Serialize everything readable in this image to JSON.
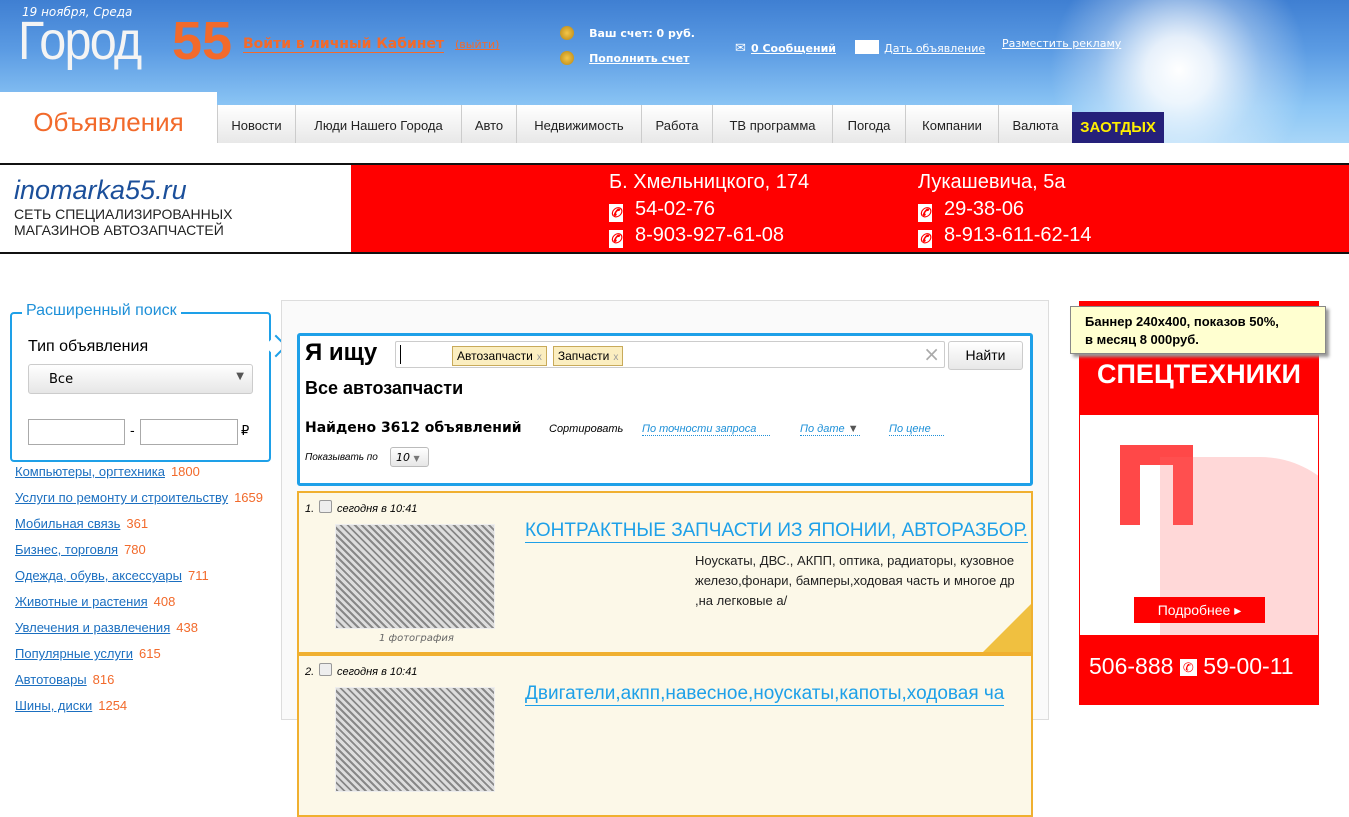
{
  "header": {
    "date": "19 ноября, Среда",
    "logo_text": "Город",
    "logo_number": "55",
    "login": "Войти в личный Кабинет",
    "logout": "(выйти)",
    "account": "Ваш счет: 0 руб.",
    "topup": "Пополнить счет",
    "messages": "0 Сообщений",
    "post_ad": "Дать объявление",
    "advertise": "Разместить рекламу"
  },
  "nav": {
    "active": "Объявления",
    "tabs": [
      "Новости",
      "Люди Нашего Города",
      "Авто",
      "Недвижимость",
      "Работа",
      "ТВ программа",
      "Погода",
      "Компании",
      "Валюта"
    ],
    "special": "ЗАОТДЫХ"
  },
  "ad_banner": {
    "site": "inomarka55.ru",
    "sub1": "СЕТЬ СПЕЦИАЛИЗИРОВАННЫХ",
    "sub2": "МАГАЗИНОВ АВТОЗАПЧАСТЕЙ",
    "addr1": "Б. Хмельницкого, 174",
    "phones1": [
      "54-02-76",
      "8-903-927-61-08"
    ],
    "addr2": "Лукашевича, 5а",
    "phones2": [
      "29-38-06",
      "8-913-611-62-14"
    ]
  },
  "adv_search": {
    "legend": "Расширенный поиск",
    "type_label": "Тип объявления",
    "type_value": "Все",
    "currency": "₽",
    "sep": "-"
  },
  "categories": [
    {
      "name": "Компьютеры, оргтехника",
      "count": "1800"
    },
    {
      "name": "Услуги по ремонту и строительству",
      "count": "1659"
    },
    {
      "name": "Мобильная связь",
      "count": "361"
    },
    {
      "name": "Бизнес, торговля",
      "count": "780"
    },
    {
      "name": "Одежда, обувь, аксессуары",
      "count": "711"
    },
    {
      "name": "Животные и растения",
      "count": "408"
    },
    {
      "name": "Увлечения и развлечения",
      "count": "438"
    },
    {
      "name": "Популярные услуги",
      "count": "615"
    },
    {
      "name": "Автотовары",
      "count": "816"
    },
    {
      "name": "Шины, диски",
      "count": "1254"
    }
  ],
  "search": {
    "label": "Я ищу",
    "tags": [
      "Автозапчасти",
      "Запчасти"
    ],
    "tag_remove": "x",
    "clear": "×",
    "button": "Найти",
    "heading": "Все автозапчасти",
    "found": "Найдено 3612 объявлений",
    "sort_label": "Сортировать",
    "sort_relevance": "По точности запроса",
    "sort_date": "По дате",
    "sort_price": "По цене",
    "per_page_label": "Показывать по",
    "per_page": "10"
  },
  "listings": [
    {
      "num": "1.",
      "date": "сегодня в 10:41",
      "title": "КОНТРАКТНЫЕ ЗАПЧАСТИ ИЗ ЯПОНИИ, АВТОРАЗБОР.",
      "desc": "Ноускаты, ДВС., АКПП, оптика, радиаторы, кузовное железо,фонари, бамперы,ходовая часть и многое др ,на легковые а/",
      "photos": "1 фотография"
    },
    {
      "num": "2.",
      "date": "сегодня в 10:41",
      "title": "Двигатели,акпп,навесное,ноускаты,капоты,ходовая ча"
    }
  ],
  "right_banner": {
    "tooltip1": "Баннер 240x400, показов 50%,",
    "tooltip2": "в месяц 8 000руб.",
    "headline": "СПЕЦТЕХНИКИ",
    "more": "Подробнее",
    "phone1": "506-888",
    "phone2": "59-00-11"
  }
}
